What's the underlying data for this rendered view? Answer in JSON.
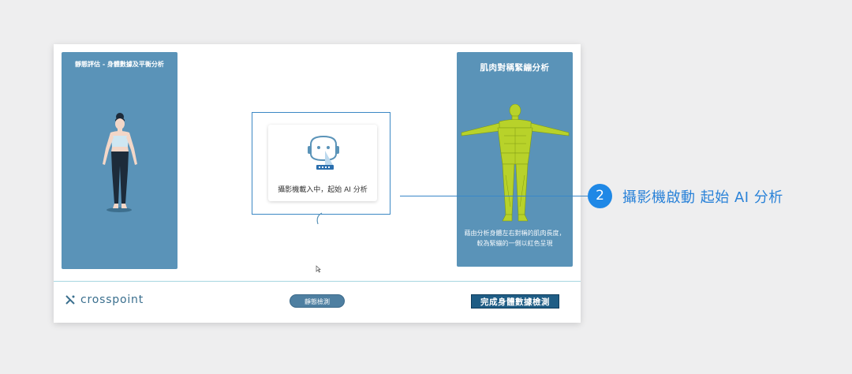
{
  "left_panel": {
    "title": "靜態評估 - 身體數據及平衡分析"
  },
  "right_panel": {
    "title": "肌肉對稱緊繃分析",
    "description": "藉由分析身體左右對稱的肌肉長度，較為緊繃的一側以紅色呈現"
  },
  "camera": {
    "status_label": "攝影機載入中，起始 AI 分析"
  },
  "footer": {
    "logo_text": "crosspoint",
    "static_test_button": "靜態檢測",
    "complete_button": "完成身體數據檢測"
  },
  "callout": {
    "number": "2",
    "text": "攝影機啟動 起始 AI 分析"
  },
  "colors": {
    "panel": "#5a93b8",
    "callout_blue": "#1f88e6",
    "muscle": "#b8d22a"
  }
}
